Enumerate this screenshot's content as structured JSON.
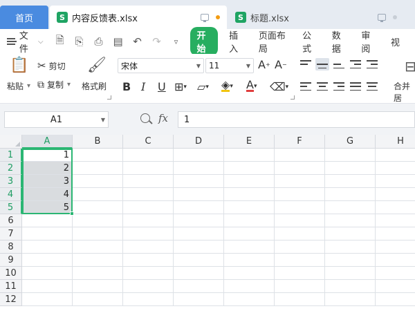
{
  "tabs": {
    "home": "首页",
    "active_doc": "内容反馈表.xlsx",
    "second_doc": "标题.xlsx",
    "sheet_icon_letter": "S"
  },
  "menu": {
    "file": "文件",
    "tabs": [
      "开始",
      "插入",
      "页面布局",
      "公式",
      "数据",
      "审阅",
      "视"
    ]
  },
  "ribbon": {
    "paste": "粘贴",
    "cut": "剪切",
    "copy": "复制",
    "format_painter": "格式刷",
    "font_name": "宋体",
    "font_size": "11",
    "merge": "合并居"
  },
  "formula_bar": {
    "cell_ref": "A1",
    "fx": "fx",
    "value": "1"
  },
  "sheet": {
    "columns": [
      "A",
      "B",
      "C",
      "D",
      "E",
      "F",
      "G",
      "H"
    ],
    "rows": [
      "1",
      "2",
      "3",
      "4",
      "5",
      "6",
      "7",
      "8",
      "9",
      "10",
      "11",
      "12"
    ],
    "cells_A": [
      "1",
      "2",
      "3",
      "4",
      "5"
    ]
  },
  "colors": {
    "accent_green": "#2bb673",
    "home_tab_blue": "#4a8be0",
    "sheet_icon_green": "#1fa463"
  }
}
